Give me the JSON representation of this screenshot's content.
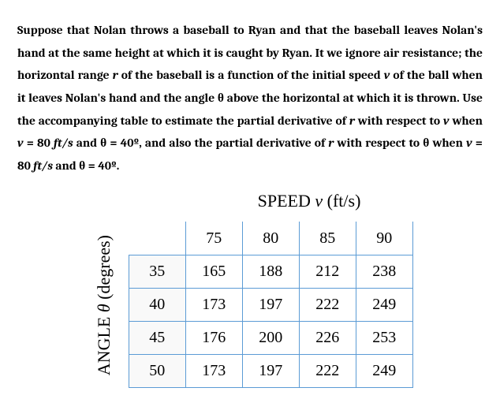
{
  "problem": {
    "t1": "Suppose that Nolan throws a baseball to Ryan and that the baseball leaves Nolan's hand at the same height at which it is caught by Ryan. It we ignore air resistance; the horizontal range ",
    "r": "r",
    "t2": " of the baseball is a function of the initial speed ",
    "v1": "v",
    "t3": " of the ball when it leaves Nolan's hand and the angle ",
    "th1": "θ",
    "t4": " above the horizontal at which it is thrown. Use the accompanying table to estimate the partial derivative of ",
    "r2": "r",
    "t5": " with respect to ",
    "v2": "v",
    "t6": " when ",
    "v3": "v",
    "t7": "  =  80 ",
    "u1": "ft/s",
    "t8": " and ",
    "th2": "θ",
    "t9": " = 40º, and also the partial derivative of ",
    "r3": "r",
    "t10": " with respect to ",
    "th3": "θ",
    "t11": " when ",
    "v4": "v",
    "t12": "  =  80 ",
    "u2": "ft/s",
    "t13": " and ",
    "th4": "θ",
    "t14": " = 40º."
  },
  "labels": {
    "speed_pre": "SPEED ",
    "speed_v": "v",
    "speed_post": " (ft/s)",
    "angle_pre": "ANGLE ",
    "angle_th": "θ",
    "angle_post": " (degrees)"
  },
  "chart_data": {
    "type": "table",
    "col_headers": [
      "75",
      "80",
      "85",
      "90"
    ],
    "row_headers": [
      "35",
      "40",
      "45",
      "50"
    ],
    "rows": [
      [
        "165",
        "188",
        "212",
        "238"
      ],
      [
        "173",
        "197",
        "222",
        "249"
      ],
      [
        "176",
        "200",
        "226",
        "253"
      ],
      [
        "173",
        "197",
        "222",
        "249"
      ]
    ]
  }
}
